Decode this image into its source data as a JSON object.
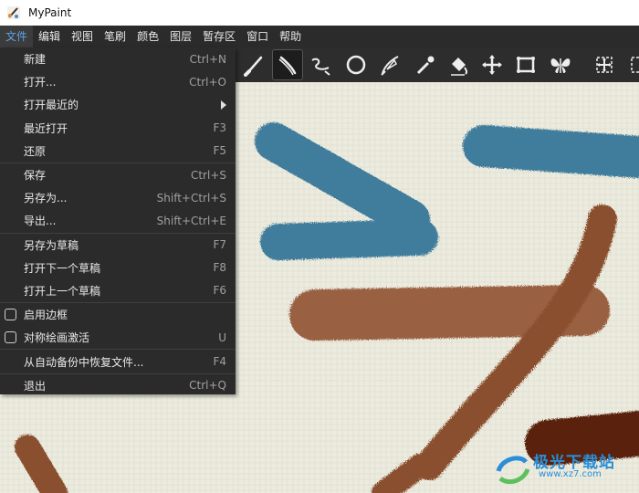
{
  "window": {
    "title": "MyPaint"
  },
  "menubar": [
    {
      "label": "文件",
      "active": true
    },
    {
      "label": "编辑"
    },
    {
      "label": "视图"
    },
    {
      "label": "笔刷"
    },
    {
      "label": "颜色"
    },
    {
      "label": "图层"
    },
    {
      "label": "暂存区"
    },
    {
      "label": "窗口"
    },
    {
      "label": "帮助"
    }
  ],
  "toolbar": {
    "tools": [
      {
        "icon": "brush-icon"
      },
      {
        "icon": "inking-icon",
        "selected": true
      },
      {
        "icon": "freehand-curve-icon"
      },
      {
        "icon": "ellipse-icon"
      },
      {
        "icon": "pen-nib-icon"
      },
      {
        "icon": "color-picker-icon"
      },
      {
        "icon": "fill-bucket-icon"
      },
      {
        "icon": "move-layer-icon"
      },
      {
        "icon": "frame-icon"
      },
      {
        "icon": "symmetry-butterfly-icon"
      },
      {
        "icon": "view-pan-icon"
      },
      {
        "icon": "view-zoom-icon"
      }
    ]
  },
  "file_menu": [
    {
      "label": "新建",
      "shortcut": "Ctrl+N"
    },
    {
      "label": "打开...",
      "shortcut": "Ctrl+O"
    },
    {
      "label": "打开最近的",
      "submenu": true
    },
    {
      "label": "最近打开",
      "shortcut": "F3"
    },
    {
      "label": "还原",
      "shortcut": "F5"
    },
    {
      "separator": true
    },
    {
      "label": "保存",
      "shortcut": "Ctrl+S"
    },
    {
      "label": "另存为...",
      "shortcut": "Shift+Ctrl+S"
    },
    {
      "label": "导出...",
      "shortcut": "Shift+Ctrl+E"
    },
    {
      "separator": true
    },
    {
      "label": "另存为草稿",
      "shortcut": "F7"
    },
    {
      "label": "打开下一个草稿",
      "shortcut": "F8"
    },
    {
      "label": "打开上一个草稿",
      "shortcut": "F6"
    },
    {
      "separator": true
    },
    {
      "label": "启用边框",
      "checkbox": true
    },
    {
      "label": "对称绘画激活",
      "shortcut": "U",
      "checkbox": true
    },
    {
      "separator": true
    },
    {
      "label": "从自动备份中恢复文件...",
      "shortcut": "F4"
    },
    {
      "separator": true
    },
    {
      "label": "退出",
      "shortcut": "Ctrl+Q"
    }
  ],
  "watermark": {
    "text": "极光下载站",
    "subtext": "www.xz7.com"
  },
  "colors": {
    "blue_stroke": "#3f7b9c",
    "brown_stroke": "#8a4f2e",
    "dark_brown": "#5a2410",
    "canvas_bg": "#ecebdf"
  }
}
